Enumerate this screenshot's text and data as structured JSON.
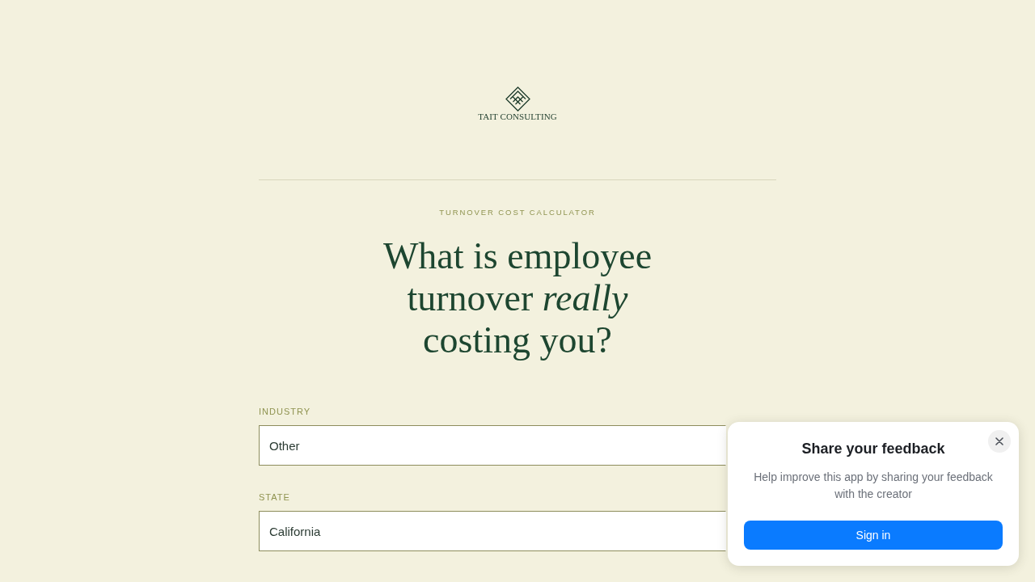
{
  "logo": {
    "text": "TAIT CONSULTING"
  },
  "eyebrow": "TURNOVER COST CALCULATOR",
  "heading": {
    "lines": [
      "What is employee",
      "turnover *really*",
      "costing you?"
    ]
  },
  "fields": [
    {
      "label": "INDUSTRY",
      "value": "Other"
    },
    {
      "label": "STATE",
      "value": "California"
    }
  ],
  "feedback_popup": {
    "title": "Share your feedback",
    "body": "Help improve this app by sharing your feedback with the creator",
    "button": "Sign in"
  }
}
